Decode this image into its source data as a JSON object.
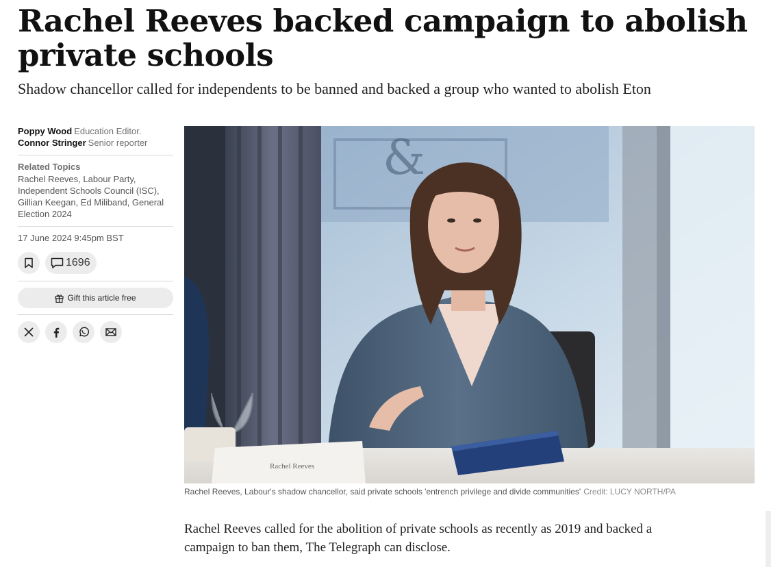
{
  "article": {
    "headline": "Rachel Reeves backed campaign to abolish private schools",
    "standfirst": "Shadow chancellor called for independents to be banned and backed a group who wanted to abolish Eton",
    "body_first_paragraph": "Rachel Reeves called for the abolition of private schools as recently as 2019 and backed a campaign to ban them, The Telegraph can disclose."
  },
  "sidebar": {
    "authors": [
      {
        "name": "Poppy Wood",
        "role": "Education Editor."
      },
      {
        "name": "Connor Stringer",
        "role": "Senior reporter"
      }
    ],
    "related_topics_heading": "Related Topics",
    "related_topics": "Rachel Reeves, Labour Party, Independent Schools Council (ISC), Gillian Keegan, Ed Miliband, General Election 2024",
    "published": "17 June 2024 9:45pm BST",
    "comment_count": "1696",
    "gift_label": "Gift this article free",
    "icons": {
      "bookmark": "bookmark-icon",
      "comments": "comment-icon",
      "gift": "gift-icon",
      "share": [
        "x-icon",
        "facebook-icon",
        "whatsapp-icon",
        "email-icon"
      ]
    }
  },
  "image": {
    "caption": "Rachel Reeves, Labour's shadow chancellor, said private schools 'entrench privilege and divide communities'",
    "credit": "Credit: LUCY NORTH/PA",
    "name_card_text": "Rachel Reeves"
  },
  "colors": {
    "text": "#111111",
    "muted": "#707070",
    "pill_bg": "#ececec"
  }
}
